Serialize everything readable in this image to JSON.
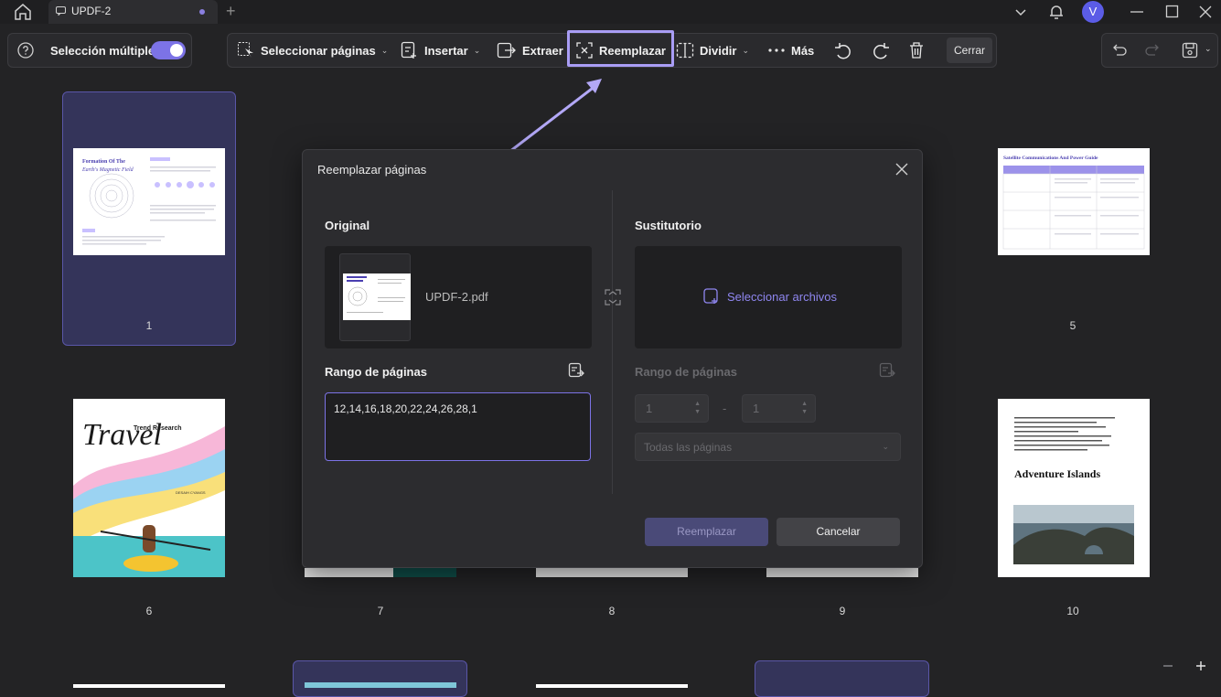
{
  "titlebar": {
    "tab_title": "UPDF-2",
    "avatar_letter": "V"
  },
  "toolbar": {
    "multi_select_label": "Selección múltiple",
    "multi_select_on": true,
    "select_pages": "Seleccionar páginas",
    "insert": "Insertar",
    "extract": "Extraer",
    "replace": "Reemplazar",
    "split": "Dividir",
    "more": "Más",
    "close": "Cerrar"
  },
  "pages": {
    "p1": "1",
    "p5": "5",
    "p6": "6",
    "p7": "7",
    "p8": "8",
    "p9": "9",
    "p10": "10",
    "p1_title": "Formation Of The",
    "p1_subtitle": "Earth's Magnetic Field",
    "p5_title": "Satellite Communications And Power Guide",
    "p6_title": "Travel",
    "p6_sub": "Trend Research",
    "p6_author": "DESAIH CYANGS",
    "p10_title": "Adventure Islands"
  },
  "dialog": {
    "title": "Reemplazar páginas",
    "original_label": "Original",
    "file_name": "UPDF-2.pdf",
    "range_label": "Rango de páginas",
    "range_value": "12,14,16,18,20,22,24,26,28,1",
    "substitute_label": "Sustitutorio",
    "select_files": "Seleccionar archivos",
    "sub_range_label": "Rango de páginas",
    "from_value": "1",
    "to_value": "1",
    "dash": "-",
    "all_pages": "Todas las páginas",
    "replace_button": "Reemplazar",
    "cancel_button": "Cancelar"
  },
  "colors": {
    "accent": "#7c73e6",
    "highlight": "#a99df5",
    "background": "#232325",
    "dialog": "#2c2c2f"
  }
}
